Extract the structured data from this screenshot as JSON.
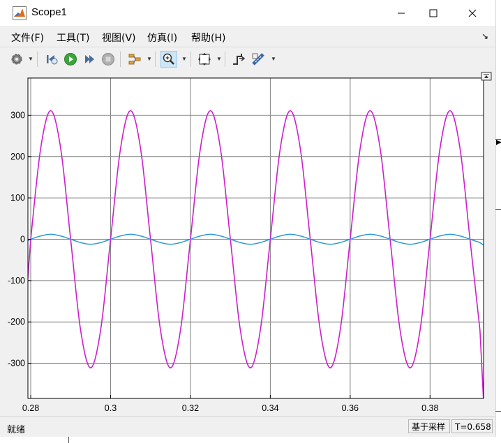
{
  "window": {
    "title": "Scope1",
    "icon": "matlab-icon"
  },
  "menu": {
    "items": [
      {
        "label": "文件(F)",
        "name": "menu-file"
      },
      {
        "label": "工具(T)",
        "name": "menu-tools"
      },
      {
        "label": "视图(V)",
        "name": "menu-view"
      },
      {
        "label": "仿真(I)",
        "name": "menu-simulation"
      },
      {
        "label": "帮助(H)",
        "name": "menu-help"
      }
    ]
  },
  "toolbar": {
    "buttons": [
      "settings-gear-icon",
      "step-back-icon",
      "run-icon",
      "step-forward-icon",
      "stop-icon",
      "highlight-signal-icon",
      "zoom-icon",
      "fit-to-view-icon",
      "triggers-icon",
      "cursor-measurements-icon"
    ]
  },
  "plot": {
    "background": "#ffffff",
    "grid_color": "#808080",
    "series_colors": [
      "#cc20cc",
      "#2b9ad3"
    ]
  },
  "chart_data": {
    "type": "line",
    "xlim": [
      0.2793,
      0.3934
    ],
    "ylim": [
      -385,
      390
    ],
    "x_ticks": [
      0.28,
      0.3,
      0.32,
      0.34,
      0.36,
      0.38
    ],
    "x_tick_labels": [
      "0.28",
      "0.3",
      "0.32",
      "0.34",
      "0.36",
      "0.38"
    ],
    "y_ticks": [
      -300,
      -200,
      -100,
      0,
      100,
      200,
      300
    ],
    "y_tick_labels": [
      "-300",
      "-200",
      "-100",
      "0",
      "100",
      "200",
      "300"
    ],
    "grid": true,
    "series": [
      {
        "color": "#cc20cc",
        "x": [
          0.28,
          0.2825,
          0.285,
          0.2875,
          0.29,
          0.2925,
          0.295,
          0.2975,
          0.3,
          0.3025,
          0.305,
          0.3075,
          0.31,
          0.3125,
          0.315,
          0.3175,
          0.32,
          0.3225,
          0.325,
          0.3275,
          0.33,
          0.3325,
          0.335,
          0.3375,
          0.34,
          0.3425,
          0.345,
          0.3475,
          0.35,
          0.3525,
          0.355,
          0.3575,
          0.36,
          0.3625,
          0.365,
          0.3675,
          0.37,
          0.3725,
          0.375,
          0.3775,
          0.38,
          0.3825,
          0.385,
          0.3875,
          0.39,
          0.3925
        ],
        "y": [
          0,
          220,
          311,
          220,
          0,
          -220,
          -311,
          -220,
          0,
          220,
          311,
          220,
          0,
          -220,
          -311,
          -220,
          0,
          220,
          311,
          220,
          0,
          -220,
          -311,
          -220,
          0,
          220,
          311,
          220,
          0,
          -220,
          -311,
          -220,
          0,
          220,
          311,
          220,
          0,
          -220,
          -311,
          -220,
          0,
          220,
          311,
          220,
          0,
          -220
        ]
      },
      {
        "color": "#2b9ad3",
        "x": [
          0.28,
          0.2825,
          0.285,
          0.2875,
          0.29,
          0.2925,
          0.295,
          0.2975,
          0.3,
          0.3025,
          0.305,
          0.3075,
          0.31,
          0.3125,
          0.315,
          0.3175,
          0.32,
          0.3225,
          0.325,
          0.3275,
          0.33,
          0.3325,
          0.335,
          0.3375,
          0.34,
          0.3425,
          0.345,
          0.3475,
          0.35,
          0.3525,
          0.355,
          0.3575,
          0.36,
          0.3625,
          0.365,
          0.3675,
          0.37,
          0.3725,
          0.375,
          0.3775,
          0.38,
          0.3825,
          0.385,
          0.3875,
          0.39,
          0.3925
        ],
        "y": [
          0,
          8,
          12,
          8,
          0,
          -8,
          -12,
          -8,
          0,
          8,
          12,
          8,
          0,
          -8,
          -12,
          -8,
          0,
          8,
          12,
          8,
          0,
          -8,
          -12,
          -8,
          0,
          8,
          12,
          8,
          0,
          -8,
          -12,
          -8,
          0,
          8,
          12,
          8,
          0,
          -8,
          -12,
          -8,
          0,
          8,
          12,
          8,
          0,
          -8
        ]
      }
    ]
  },
  "status": {
    "left": "就绪",
    "mode": "基于采样",
    "time": "T=0.658"
  }
}
